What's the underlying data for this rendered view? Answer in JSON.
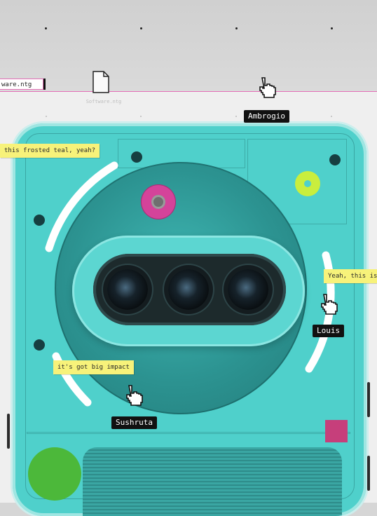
{
  "file": {
    "bar_label": "ware.ntg",
    "icon": "document-icon",
    "caption": "Software.ntg"
  },
  "comments": {
    "frosted_teal": "this frosted teal, yeah?",
    "yeah_this_is": "Yeah, this is",
    "big_impact": "it's got big impact"
  },
  "cursors": [
    {
      "name": "Ambrogio",
      "icon": "hand-pointer-icon"
    },
    {
      "name": "Louis",
      "icon": "hand-pointer-icon"
    },
    {
      "name": "Sushruta",
      "icon": "hand-pointer-icon"
    }
  ],
  "colors": {
    "phone_teal": "#4fd0cb",
    "comment_yellow": "#f7f27a",
    "accent_pink": "#d4439a",
    "accent_lime": "#c9ee3d",
    "accent_green": "#4cb83a",
    "selection_pink": "#e36fb6"
  }
}
